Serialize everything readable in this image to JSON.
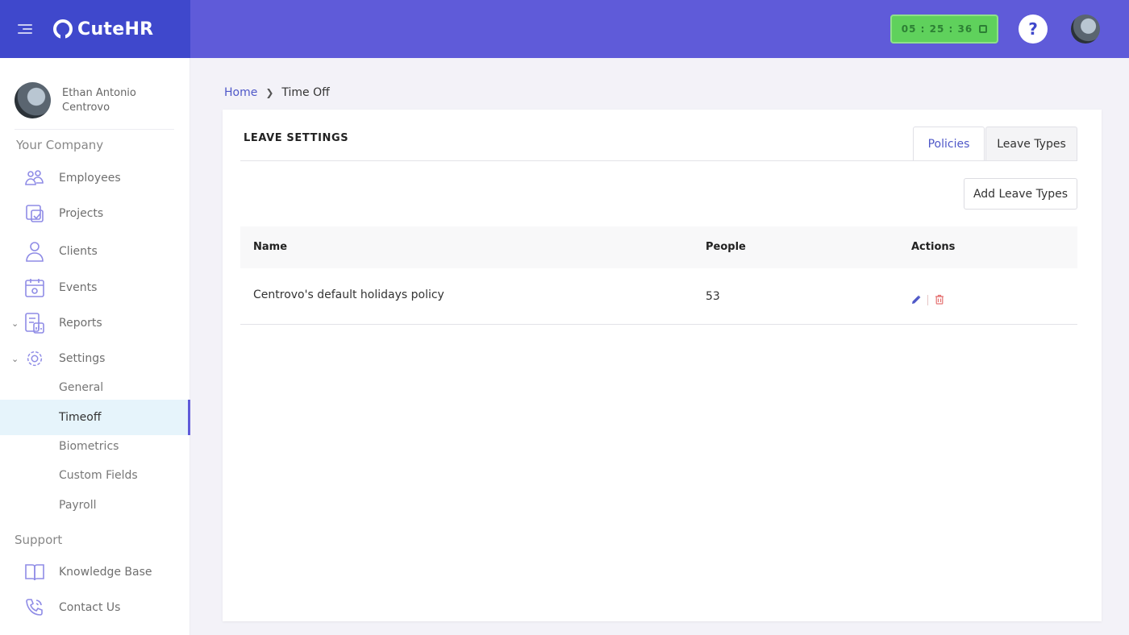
{
  "app": {
    "name": "CuteHR"
  },
  "header": {
    "timer": "05 : 25 : 36",
    "help_label": "?"
  },
  "user": {
    "name": "Ethan Antonio Centrovo"
  },
  "sidebar": {
    "company_title": "Your Company",
    "items": [
      {
        "label": "Employees",
        "icon": "employees-icon"
      },
      {
        "label": "Projects",
        "icon": "projects-icon"
      },
      {
        "label": "Clients",
        "icon": "clients-icon"
      },
      {
        "label": "Events",
        "icon": "events-icon"
      },
      {
        "label": "Reports",
        "icon": "reports-icon"
      },
      {
        "label": "Settings",
        "icon": "settings-icon"
      }
    ],
    "settings_sub": [
      "General",
      "Timeoff",
      "Biometrics",
      "Custom Fields",
      "Payroll"
    ],
    "active_sub": "Timeoff",
    "support_title": "Support",
    "support_items": [
      {
        "label": "Knowledge Base",
        "icon": "book-icon"
      },
      {
        "label": "Contact Us",
        "icon": "phone-icon"
      }
    ]
  },
  "breadcrumb": {
    "home": "Home",
    "current": "Time Off"
  },
  "card": {
    "title": "LEAVE SETTINGS",
    "tabs": {
      "policies": "Policies",
      "leave_types": "Leave Types"
    },
    "add_button": "Add Leave Types",
    "table": {
      "headers": {
        "name": "Name",
        "people": "People",
        "actions": "Actions"
      },
      "rows": [
        {
          "name": "Centrovo's default holidays policy",
          "people": "53"
        }
      ]
    }
  },
  "colors": {
    "brand": "#3f48cc",
    "topbar": "#5f5bd9",
    "timer": "#5fd15c",
    "delete": "#e57373"
  }
}
